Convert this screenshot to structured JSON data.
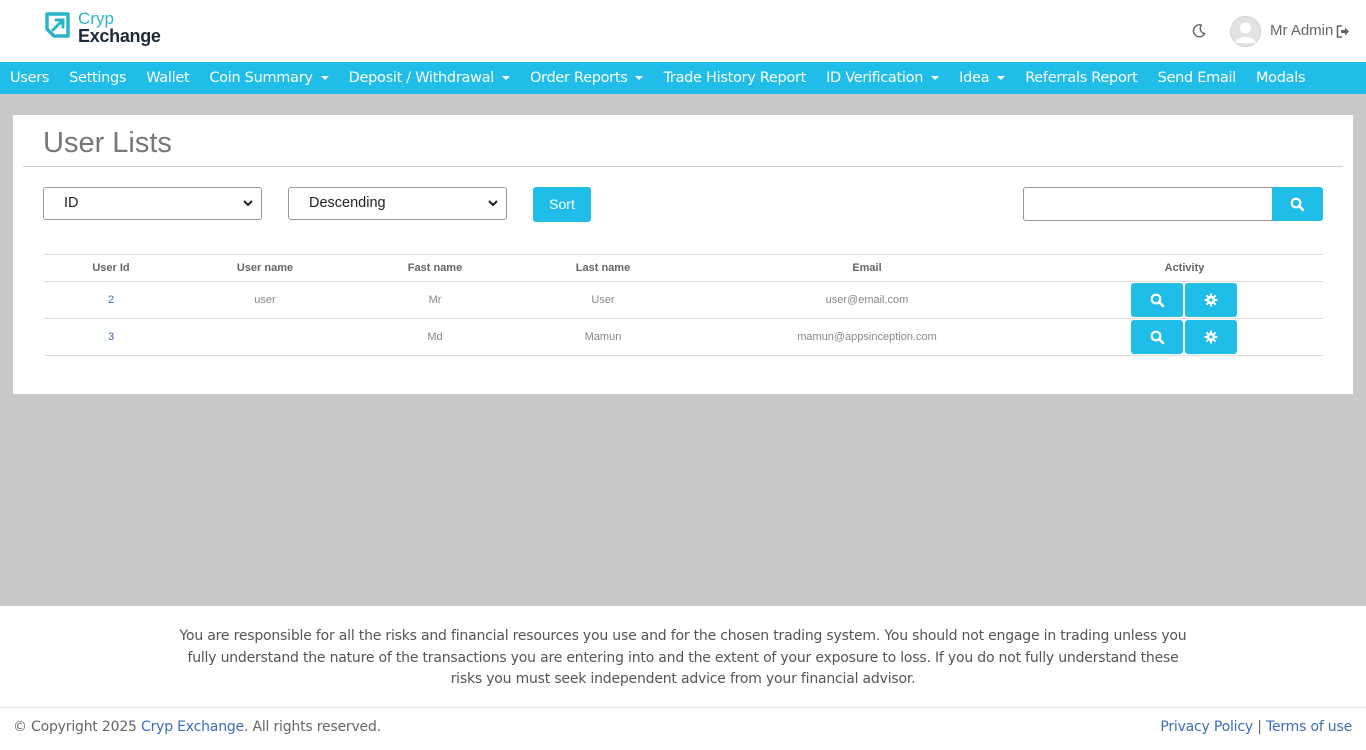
{
  "header": {
    "logo_line1": "Cryp",
    "logo_line2": "Exchange",
    "user_name": "Mr Admin"
  },
  "nav": {
    "items": [
      {
        "label": "Users",
        "dropdown": false
      },
      {
        "label": "Settings",
        "dropdown": false
      },
      {
        "label": "Wallet",
        "dropdown": false
      },
      {
        "label": "Coin Summary",
        "dropdown": true
      },
      {
        "label": "Deposit / Withdrawal",
        "dropdown": true
      },
      {
        "label": "Order Reports",
        "dropdown": true
      },
      {
        "label": "Trade History Report",
        "dropdown": false
      },
      {
        "label": "ID Verification",
        "dropdown": true
      },
      {
        "label": "Idea",
        "dropdown": true
      },
      {
        "label": "Referrals Report",
        "dropdown": false
      },
      {
        "label": "Send Email",
        "dropdown": false
      },
      {
        "label": "Modals",
        "dropdown": false
      }
    ]
  },
  "main": {
    "title": "User Lists",
    "sort_field": "ID",
    "sort_order": "Descending",
    "sort_button": "Sort",
    "search_value": ""
  },
  "table": {
    "headers": [
      "User Id",
      "User name",
      "Fast name",
      "Last name",
      "Email",
      "Activity"
    ],
    "rows": [
      {
        "user_id": "2",
        "user_name": "user",
        "first_name": "Mr",
        "last_name": "User",
        "email": "user@email.com"
      },
      {
        "user_id": "3",
        "user_name": "",
        "first_name": "Md",
        "last_name": "Mamun",
        "email": "mamun@appsinception.com"
      }
    ]
  },
  "footer": {
    "disclaimer": "You are responsible for all the risks and financial resources you use and for the chosen trading system. You should not engage in trading unless you fully understand the nature of the transactions you are entering into and the extent of your exposure to loss. If you do not fully understand these risks you must seek independent advice from your financial advisor.",
    "copyright_prefix": "© Copyright 2025 ",
    "copyright_brand": "Cryp Exchange",
    "copyright_suffix": ". All rights reserved.",
    "privacy": "Privacy Policy",
    "separator": " | ",
    "terms": "Terms of use"
  },
  "colors": {
    "accent": "#1fbde8",
    "link": "#3c6db5",
    "logo_teal": "#2bb3c7",
    "logo_dark": "#1e2a3a"
  },
  "icons": [
    "logo-icon",
    "moon-icon",
    "avatar",
    "logout-icon",
    "chevron-down-icon",
    "search-icon",
    "gear-icon"
  ]
}
